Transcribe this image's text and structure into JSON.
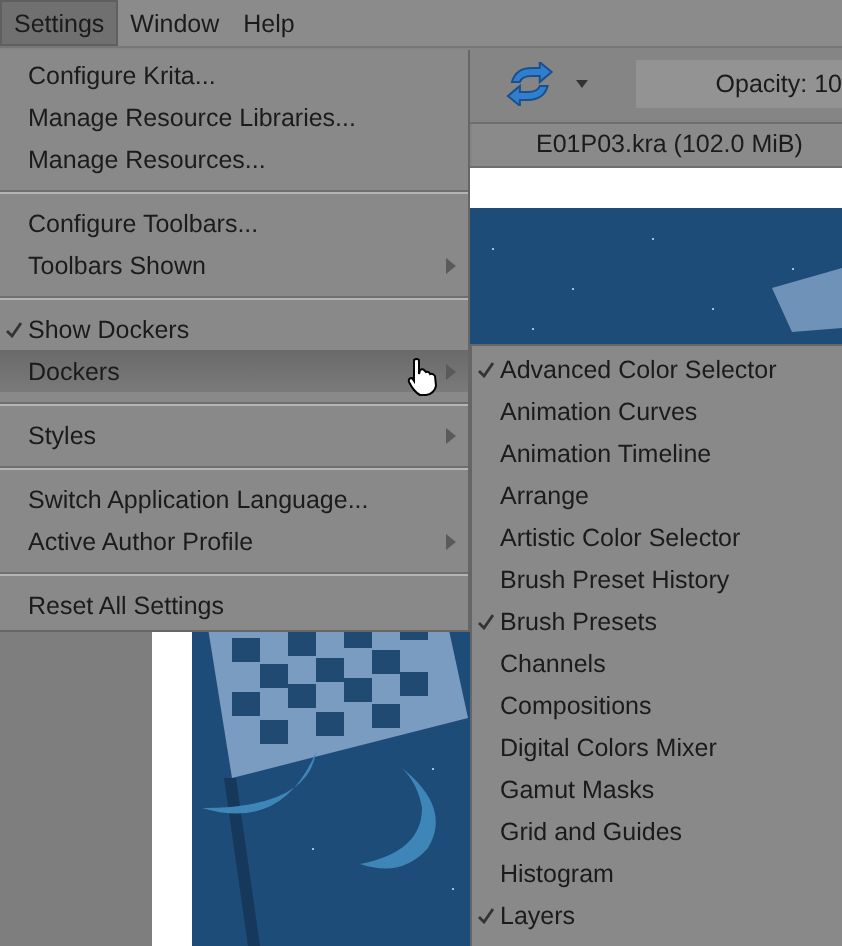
{
  "menu_bar": [
    {
      "label": "Settings",
      "selected": true
    },
    {
      "label": "Window",
      "selected": false
    },
    {
      "label": "Help",
      "selected": false
    }
  ],
  "toolbar": {
    "opacity_field": "Opacity: 10"
  },
  "document_tab": {
    "title": "E01P03.kra (102.0 MiB)"
  },
  "canvas": {
    "kind": "picture"
  },
  "settings_menu": [
    [
      {
        "label": "Configure Krita...",
        "checked": false,
        "submenu": false,
        "highlighted": false
      },
      {
        "label": "Manage Resource Libraries...",
        "checked": false,
        "submenu": false,
        "highlighted": false
      },
      {
        "label": "Manage Resources...",
        "checked": false,
        "submenu": false,
        "highlighted": false
      }
    ],
    [
      {
        "label": "Configure Toolbars...",
        "checked": false,
        "submenu": false,
        "highlighted": false
      },
      {
        "label": "Toolbars Shown",
        "checked": false,
        "submenu": true,
        "highlighted": false
      }
    ],
    [
      {
        "label": "Show Dockers",
        "checked": true,
        "submenu": false,
        "highlighted": false
      },
      {
        "label": "Dockers",
        "checked": false,
        "submenu": true,
        "highlighted": true
      }
    ],
    [
      {
        "label": "Styles",
        "checked": false,
        "submenu": true,
        "highlighted": false
      }
    ],
    [
      {
        "label": "Switch Application Language...",
        "checked": false,
        "submenu": false,
        "highlighted": false
      },
      {
        "label": "Active Author Profile",
        "checked": false,
        "submenu": true,
        "highlighted": false
      }
    ],
    [
      {
        "label": "Reset All Settings",
        "checked": false,
        "submenu": false,
        "highlighted": false
      }
    ]
  ],
  "dockers_submenu": [
    {
      "label": "Advanced Color Selector",
      "checked": true
    },
    {
      "label": "Animation Curves",
      "checked": false
    },
    {
      "label": "Animation Timeline",
      "checked": false
    },
    {
      "label": "Arrange",
      "checked": false
    },
    {
      "label": "Artistic Color Selector",
      "checked": false
    },
    {
      "label": "Brush Preset History",
      "checked": false
    },
    {
      "label": "Brush Presets",
      "checked": true
    },
    {
      "label": "Channels",
      "checked": false
    },
    {
      "label": "Compositions",
      "checked": false
    },
    {
      "label": "Digital Colors Mixer",
      "checked": false
    },
    {
      "label": "Gamut Masks",
      "checked": false
    },
    {
      "label": "Grid and Guides",
      "checked": false
    },
    {
      "label": "Histogram",
      "checked": false
    },
    {
      "label": "Layers",
      "checked": true
    }
  ]
}
